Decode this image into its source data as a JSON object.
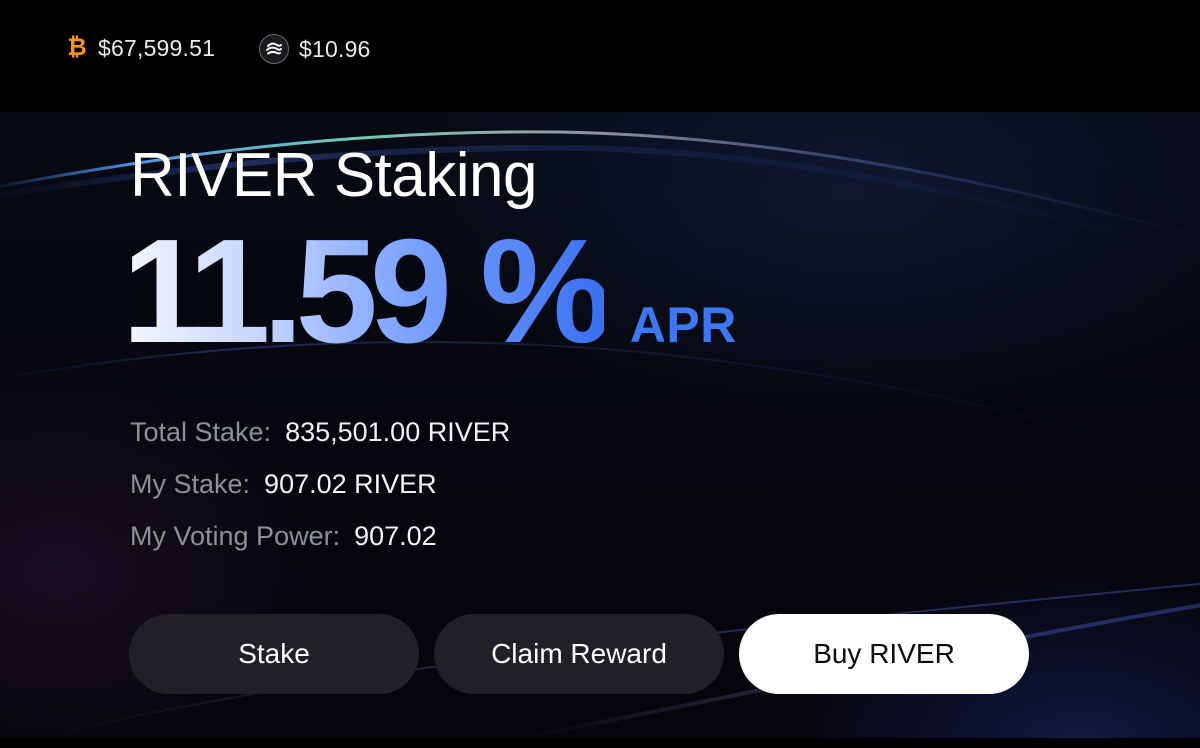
{
  "tickers": [
    {
      "icon": "bitcoin-icon",
      "price": "$67,599.51",
      "color": "#f7931a"
    },
    {
      "icon": "river-token-icon",
      "price": "$10.96"
    }
  ],
  "hero": {
    "title": "RIVER Staking",
    "apr_value": "11.59",
    "apr_percent": "%",
    "apr_label": "APR",
    "accent_color": "#3d78f2"
  },
  "stats": [
    {
      "label": "Total Stake:",
      "value": "835,501.00 RIVER"
    },
    {
      "label": "My Stake:",
      "value": "907.02 RIVER"
    },
    {
      "label": "My Voting Power:",
      "value": "907.02"
    }
  ],
  "actions": {
    "stake_label": "Stake",
    "claim_label": "Claim Reward",
    "buy_label": "Buy RIVER"
  }
}
